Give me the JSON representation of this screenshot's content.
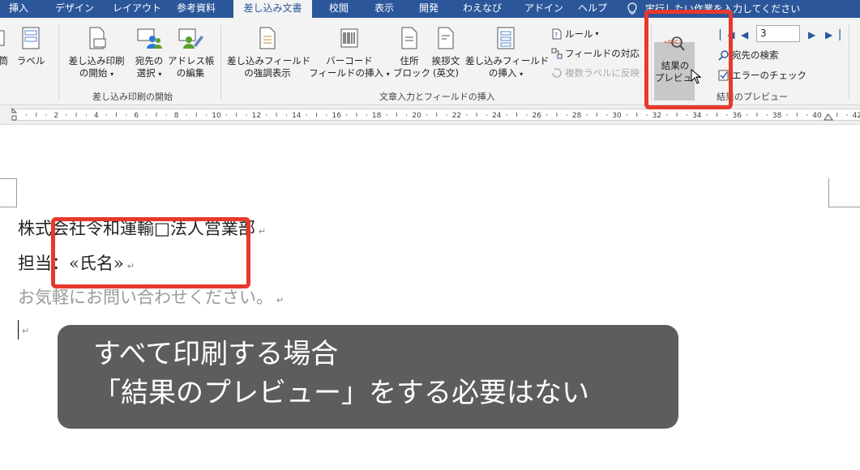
{
  "tabs": [
    "挿入",
    "デザイン",
    "レイアウト",
    "参考資料",
    "差し込み文書",
    "校閲",
    "表示",
    "開発",
    "わえなび",
    "アドイン",
    "ヘルプ"
  ],
  "active_tab_index": 4,
  "tell_me": "実行したい作業を入力してください",
  "ribbon": {
    "groups": {
      "start": "差し込み印刷の開始",
      "fields": "文章入力とフィールドの挿入",
      "preview": "結果のプレビュー"
    },
    "buttons": {
      "envelopes": "封筒",
      "labels": "ラベル",
      "start_merge": [
        "差し込み印刷",
        "の開始"
      ],
      "select_recipients": [
        "宛先の",
        "選択"
      ],
      "edit_list": [
        "アドレス帳",
        "の編集"
      ],
      "highlight_fields": [
        "差し込みフィールド",
        "の強調表示"
      ],
      "barcode": [
        "バーコード",
        "フィールドの挿入"
      ],
      "address_block": [
        "住所",
        "ブロック"
      ],
      "greeting": [
        "挨拶文",
        "(英文)"
      ],
      "insert_field": [
        "差し込みフィールド",
        "の挿入"
      ],
      "rules": "ルール",
      "match_fields": "フィールドの対応",
      "update_labels": "複数ラベルに反映",
      "preview_results": [
        "結果の",
        "プレビュー"
      ],
      "find_recipient": "宛先の検索",
      "check_errors": "エラーのチェック",
      "record_number": "3"
    }
  },
  "ruler": {
    "labels": [
      "2",
      "4",
      "6",
      "8",
      "10",
      "12",
      "14",
      "16",
      "18",
      "20",
      "22",
      "24",
      "26",
      "28",
      "30",
      "32",
      "34",
      "36",
      "38",
      "40",
      "42"
    ]
  },
  "document": {
    "line1": "株式会社令和運輸□法人営業部",
    "line2_prefix": "担当：",
    "line2_field": "«氏名»",
    "line3": "お気軽にお問い合わせください。",
    "para_mark": "↵"
  },
  "caption": {
    "line1": "すべて印刷する場合",
    "line2": "「結果のプレビュー」をする必要はない"
  },
  "colors": {
    "tabbar": "#2b579a",
    "ribbon": "#f3f3f3",
    "highlight": "#e8382d",
    "caption_bg": "#5f5d5c"
  }
}
